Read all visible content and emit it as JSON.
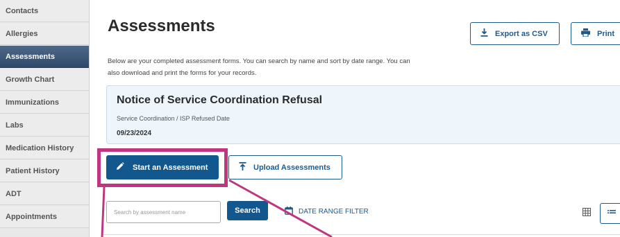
{
  "sidebar": {
    "items": [
      {
        "label": "Contacts"
      },
      {
        "label": "Allergies"
      },
      {
        "label": "Assessments"
      },
      {
        "label": "Growth Chart"
      },
      {
        "label": "Immunizations"
      },
      {
        "label": "Labs"
      },
      {
        "label": "Medication History"
      },
      {
        "label": "Patient History"
      },
      {
        "label": "ADT"
      },
      {
        "label": "Appointments"
      }
    ],
    "active": "Assessments"
  },
  "header": {
    "title": "Assessments",
    "description": "Below are your completed assessment forms. You can search by name and sort by date range. You can also download and print the forms for your records.",
    "export_label": "Export as CSV",
    "print_label": "Print"
  },
  "card": {
    "title": "Notice of Service Coordination Refusal",
    "subtitle": "Service Coordination / ISP Refused Date",
    "date": "09/23/2024"
  },
  "actions": {
    "start_label": "Start an Assessment",
    "upload_label": "Upload Assessments"
  },
  "search": {
    "placeholder": "Search by assessment name",
    "value": "",
    "button_label": "Search",
    "date_filter_label": "DATE RANGE FILTER"
  },
  "colors": {
    "accent": "#13578f",
    "highlight": "#c0357f",
    "sidebar_active": "#2f4a6c"
  }
}
